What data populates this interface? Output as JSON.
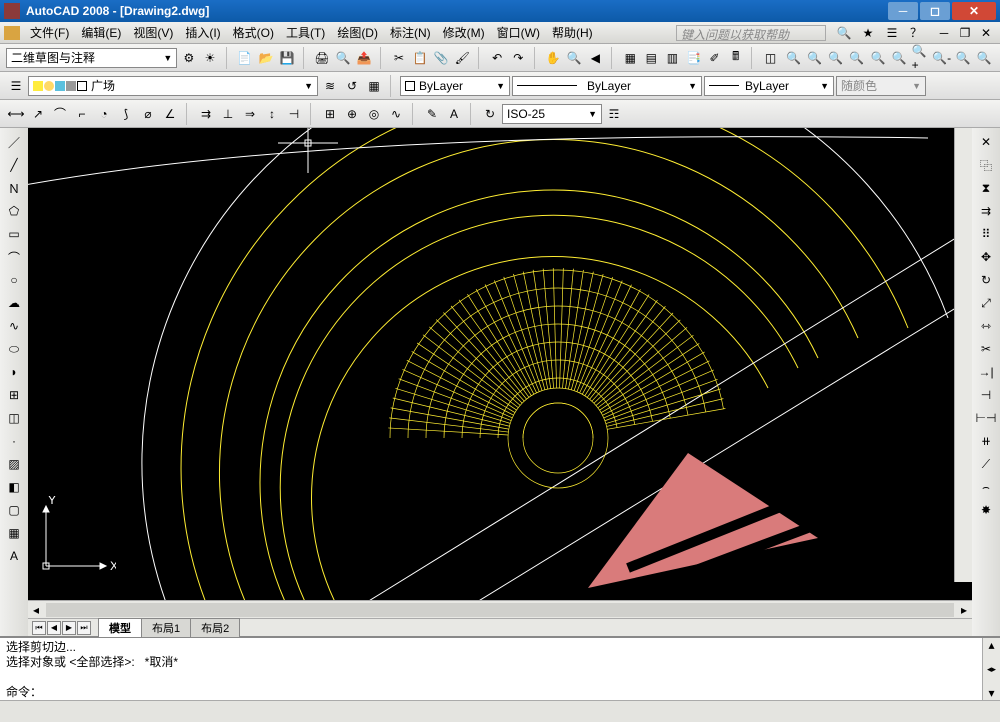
{
  "app": {
    "title": "AutoCAD 2008 - [Drawing2.dwg]"
  },
  "menubar": {
    "items": [
      "文件(F)",
      "编辑(E)",
      "视图(V)",
      "插入(I)",
      "格式(O)",
      "工具(T)",
      "绘图(D)",
      "标注(N)",
      "修改(M)",
      "窗口(W)",
      "帮助(H)"
    ],
    "search_placeholder": "键入问题以获取帮助"
  },
  "workspace": {
    "value": "二维草图与注释"
  },
  "layer": {
    "current": "广场"
  },
  "props": {
    "color": "ByLayer",
    "linetype": "ByLayer",
    "lineweight": "ByLayer",
    "plotstyle": "随颜色"
  },
  "dimstyle": {
    "value": "ISO-25"
  },
  "tabs": {
    "items": [
      "模型",
      "布局1",
      "布局2"
    ],
    "active": 0
  },
  "cmd": {
    "line1": "选择剪切边...",
    "line2": "选择对象或 <全部选择>:   *取消*",
    "prompt": "命令："
  },
  "ucs": {
    "x": "X",
    "y": "Y"
  }
}
